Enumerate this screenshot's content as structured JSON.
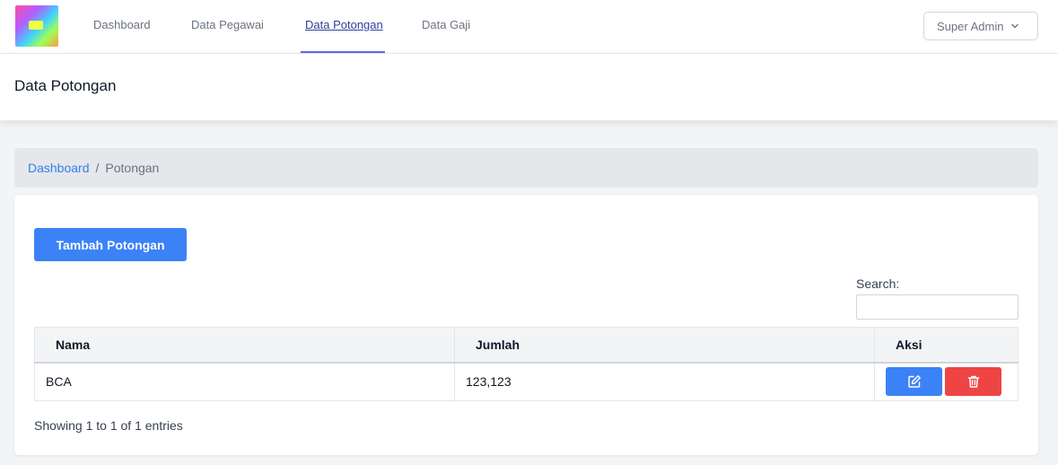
{
  "nav": {
    "items": [
      {
        "label": "Dashboard"
      },
      {
        "label": "Data Pegawai"
      },
      {
        "label": "Data Potongan",
        "active": true
      },
      {
        "label": "Data Gaji"
      }
    ],
    "user_menu_label": "Super Admin",
    "logo_icon": "app-logo"
  },
  "page": {
    "title": "Data Potongan"
  },
  "breadcrumb": {
    "link": "Dashboard",
    "separator": "/",
    "current": "Potongan"
  },
  "card": {
    "add_button_label": "Tambah Potongan",
    "search_label": "Search:",
    "search_value": "",
    "table": {
      "headers": [
        "Nama",
        "Jumlah",
        "Aksi"
      ],
      "rows": [
        {
          "nama": "BCA",
          "jumlah": "123,123",
          "actions": [
            "edit-icon",
            "trash-icon"
          ]
        }
      ]
    },
    "info_text": "Showing 1 to 1 of 1 entries"
  },
  "colors": {
    "primary": "#3b82f6",
    "danger": "#ef4444",
    "link": "#2f80ed",
    "active_nav_underline": "#6366f1"
  }
}
